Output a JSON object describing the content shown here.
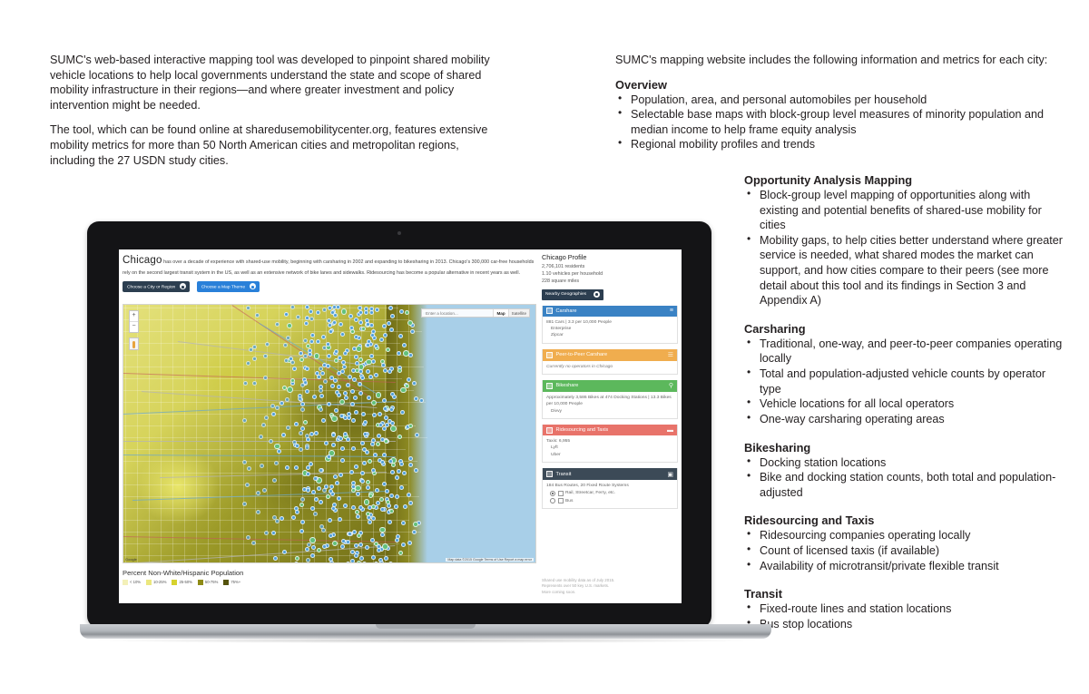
{
  "document": {
    "left_column": {
      "paragraphs": [
        "SUMC's web-based interactive mapping tool was developed to pinpoint shared mobility vehicle locations to help local governments understand the state and scope of shared mobility infrastructure in their regions—and where greater investment and policy intervention might be needed.",
        "The tool, which can be found online at sharedusemobilitycenter.org, features extensive mobility metrics for more than 50 North American cities and metropolitan regions, including the 27 USDN study cities."
      ]
    },
    "right_column": {
      "intro": "SUMC's mapping website includes the following information and metrics for each city:",
      "sections": [
        {
          "heading": "Overview",
          "bullets": [
            "Population, area, and personal automobiles per household",
            "Selectable base maps with block-group level measures of minority population and median income to help frame equity analysis",
            "Regional mobility profiles and trends"
          ]
        },
        {
          "heading": "Opportunity Analysis Mapping",
          "bullets": [
            "Block-group level mapping of opportunities along with existing and potential benefits of shared-use mobility for cities",
            "Mobility gaps, to help cities better understand where greater service is needed, what shared modes the market can support, and how cities compare to their peers (see more detail about this tool and its findings in Section 3 and Appendix A)"
          ]
        },
        {
          "heading": "Carsharing",
          "bullets": [
            "Traditional, one-way, and peer-to-peer companies operating locally",
            "Total and population-adjusted vehicle counts by operator type",
            "Vehicle locations for all local operators",
            "One-way carsharing operating areas"
          ]
        },
        {
          "heading": "Bikesharing",
          "bullets": [
            "Docking station locations",
            "Bike and docking station counts, both total and population-adjusted"
          ]
        },
        {
          "heading": "Ridesourcing and Taxis",
          "bullets": [
            "Ridesourcing companies operating locally",
            "Count of licensed taxis (if available)",
            "Availability of microtransit/private flexible transit"
          ]
        },
        {
          "heading": "Transit",
          "bullets": [
            "Fixed-route lines and station locations",
            "Bus stop locations"
          ]
        }
      ]
    }
  },
  "app": {
    "city_name": "Chicago",
    "city_intro": " has over a decade of experience with shared-use mobility, beginning with carsharing in 2002 and expanding to bikesharing in 2013. Chicago's 300,000 car-free households rely on the second largest transit system in the US, as well as an extensive network of bike lanes and sidewalks. Ridesourcing has become a popular alternative in recent years as well.",
    "buttons": {
      "city_region": "Choose a City or Region",
      "map_theme": "Choose a Map Theme"
    },
    "map": {
      "search_placeholder": "Enter a location...",
      "type_map": "Map",
      "type_satellite": "Satellite",
      "zoom_in": "+",
      "zoom_out": "−",
      "attribution": "Map data ©2015 Google     Terms of Use     Report a map error"
    },
    "legend": {
      "title": "Percent Non-White/Hispanic Population",
      "items": [
        {
          "label": "< 10%",
          "color": "#f3f0b8"
        },
        {
          "label": "10-25%",
          "color": "#ebe77e"
        },
        {
          "label": "25-50%",
          "color": "#d6d22e"
        },
        {
          "label": "50-75%",
          "color": "#8e8b16"
        },
        {
          "label": "75%+",
          "color": "#55530c"
        }
      ]
    },
    "panel": {
      "title": "Chicago Profile",
      "stats": [
        "2,706,101 residents",
        "1.10 vehicles per household",
        "228 square miles"
      ],
      "nearby_label": "Nearby Geographies",
      "modules": [
        {
          "name": "Carshare",
          "color": "#3a82c4",
          "icon": "carshare-icon",
          "summary": "881 Cars | 3.3 per 10,000 People",
          "operators": [
            "Enterprise",
            "Zipcar"
          ],
          "note": ""
        },
        {
          "name": "Peer-to-Peer Carshare",
          "color": "#f0ad4e",
          "icon": "peer-carshare-icon",
          "summary": "",
          "operators": [],
          "note": "Currently no operators in Chicago"
        },
        {
          "name": "Bikeshare",
          "color": "#5cb85c",
          "icon": "bike-icon",
          "summary": "Approximately 3,586 Bikes at 474 Docking Stations | 13.3 Bikes per 10,000 People",
          "operators": [
            "Divvy"
          ],
          "note": ""
        },
        {
          "name": "Ridesourcing and Taxis",
          "color": "#e8736a",
          "icon": "taxi-icon",
          "summary": "Taxis: 6,955",
          "operators": [
            "Lyft",
            "Uber"
          ],
          "note": ""
        },
        {
          "name": "Transit",
          "color": "#3c4a57",
          "icon": "train-icon",
          "summary": "184 Bus Routes, 20 Fixed Route Systems",
          "operators": [],
          "note": ""
        }
      ],
      "transit_options": [
        {
          "label": "Rail, Streetcar, Ferry, etc.",
          "selected": true
        },
        {
          "label": "Bus",
          "selected": false
        }
      ],
      "footer": [
        "Shared use mobility data as of July 2015.",
        "Represents over 50 key U.S. markets.",
        "More coming soon."
      ]
    }
  }
}
